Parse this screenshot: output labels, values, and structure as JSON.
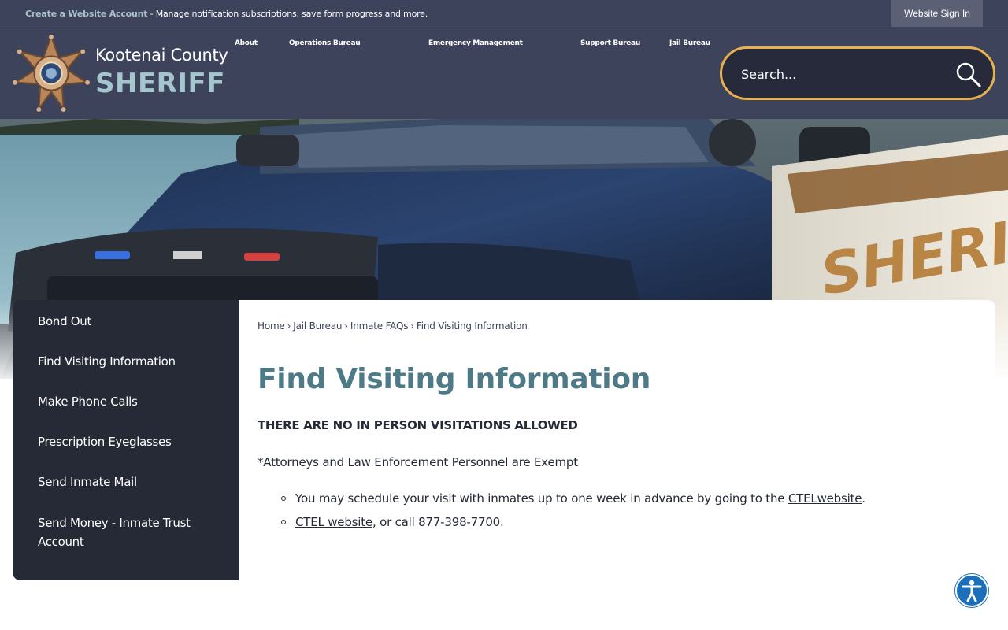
{
  "topbar": {
    "account_link": "Create a Website Account",
    "account_message": " - Manage notification subscriptions, save form progress and more.",
    "signin_label": "Website Sign In"
  },
  "header": {
    "county": "Kootenai County",
    "sheriff": "SHERIFF",
    "nav": [
      "About",
      "Operations Bureau",
      "Emergency Management",
      "Support Bureau",
      "Jail Bureau"
    ],
    "search_placeholder": "Search..."
  },
  "hero": {
    "image": "sheriff-patrol-vehicle-photo"
  },
  "sidebar": {
    "items": [
      "Bond Out",
      "Find Visiting Information",
      "Make Phone Calls",
      "Prescription Eyeglasses",
      "Send Inmate Mail",
      "Send Money - Inmate Trust Account"
    ]
  },
  "breadcrumb": [
    "Home",
    "Jail Bureau",
    "Inmate FAQs",
    "Find Visiting Information"
  ],
  "main": {
    "title": "Find Visiting Information",
    "notice": "THERE ARE NO IN PERSON VISITATIONS ALLOWED",
    "exempt": "*Attorneys and Law Enforcement Personnel are Exempt",
    "bullet1_text": "You may schedule your visit with inmates up to one week in advance by going to the ",
    "bullet1_link": "CTELwebsite",
    "bullet1_end": ".",
    "bullet2_link": "CTEL website",
    "bullet2_text": ", or call 877-398-7700."
  },
  "colors": {
    "header_bg": "#3d435a",
    "accent_gold": "#e8b04f",
    "title_teal": "#4e7a87",
    "sidebar_bg": "#262a36"
  },
  "icons": {
    "search": "magnifier-icon",
    "accessibility": "accessibility-icon",
    "badge": "sheriff-star-badge"
  }
}
